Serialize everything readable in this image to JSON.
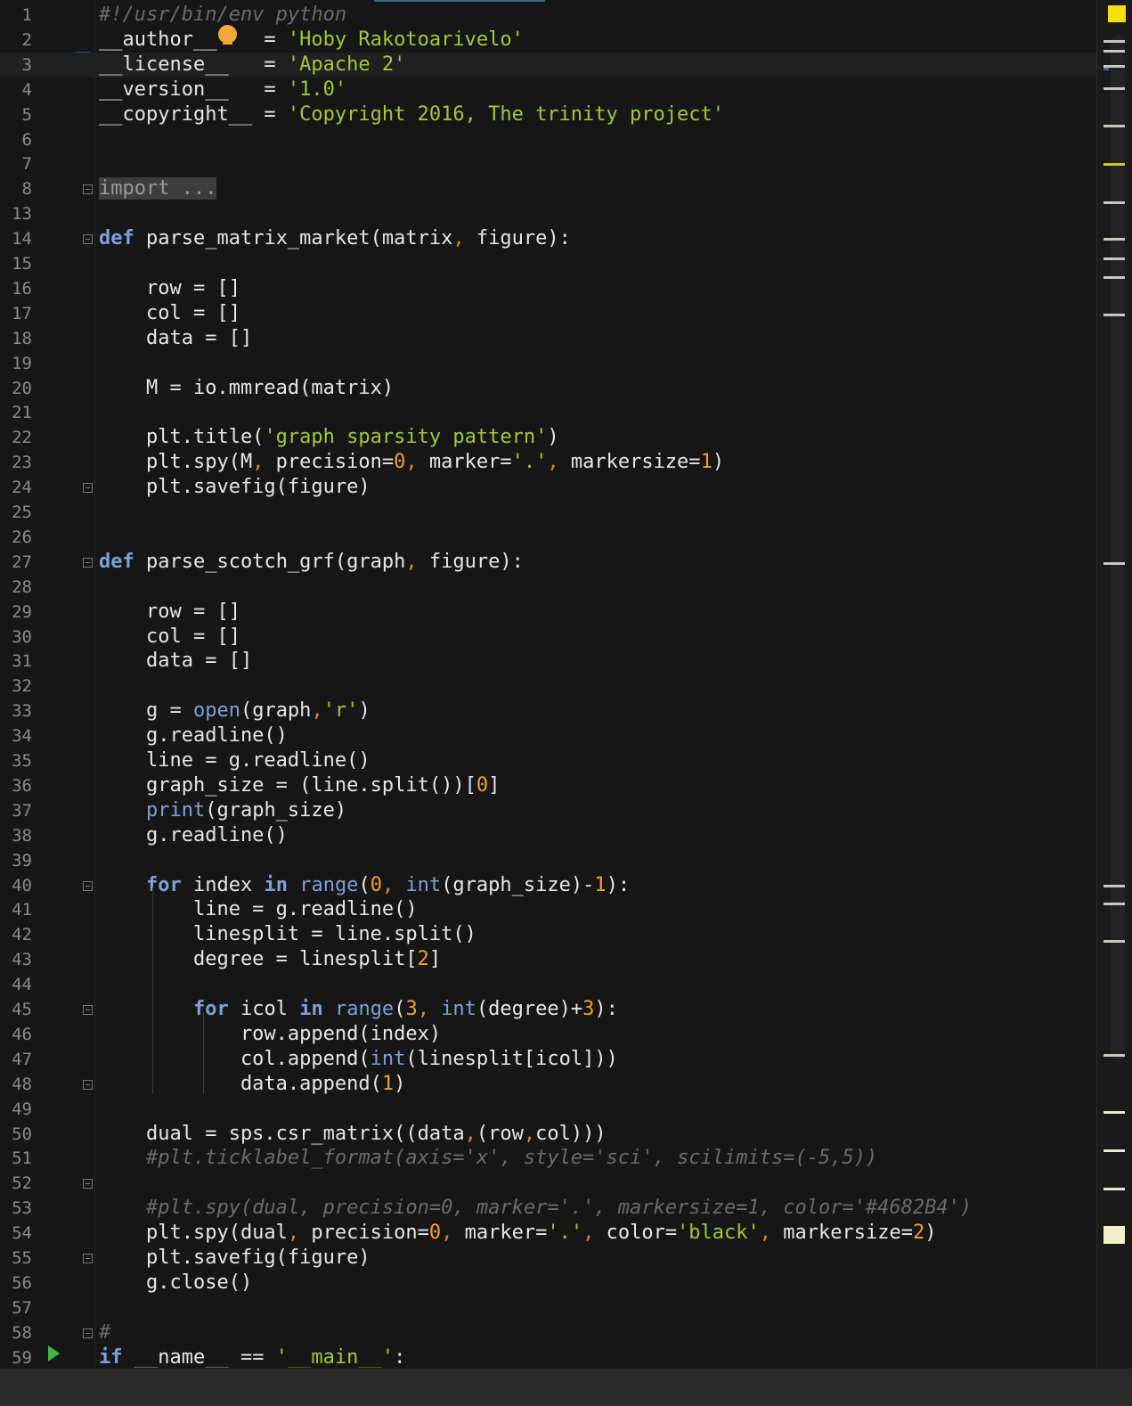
{
  "editor": {
    "language": "python",
    "current_line": 3,
    "lines": [
      {
        "n": "1",
        "t": "#!/usr/bin/env python"
      },
      {
        "n": "2",
        "t": "__author__    = 'Hoby Rakotoarivelo'"
      },
      {
        "n": "3",
        "t": "__license__   = 'Apache 2'"
      },
      {
        "n": "4",
        "t": "__version__   = '1.0'"
      },
      {
        "n": "5",
        "t": "__copyright__ = 'Copyright 2016, The trinity project'"
      },
      {
        "n": "6",
        "t": ""
      },
      {
        "n": "7",
        "t": ""
      },
      {
        "n": "8",
        "t": "import ..."
      },
      {
        "n": "13",
        "t": ""
      },
      {
        "n": "14",
        "t": "def parse_matrix_market(matrix, figure):"
      },
      {
        "n": "15",
        "t": ""
      },
      {
        "n": "16",
        "t": "    row = []"
      },
      {
        "n": "17",
        "t": "    col = []"
      },
      {
        "n": "18",
        "t": "    data = []"
      },
      {
        "n": "19",
        "t": ""
      },
      {
        "n": "20",
        "t": "    M = io.mmread(matrix)"
      },
      {
        "n": "21",
        "t": ""
      },
      {
        "n": "22",
        "t": "    plt.title('graph sparsity pattern')"
      },
      {
        "n": "23",
        "t": "    plt.spy(M, precision=0, marker='.', markersize=1)"
      },
      {
        "n": "24",
        "t": "    plt.savefig(figure)"
      },
      {
        "n": "25",
        "t": ""
      },
      {
        "n": "26",
        "t": ""
      },
      {
        "n": "27",
        "t": "def parse_scotch_grf(graph, figure):"
      },
      {
        "n": "28",
        "t": ""
      },
      {
        "n": "29",
        "t": "    row = []"
      },
      {
        "n": "30",
        "t": "    col = []"
      },
      {
        "n": "31",
        "t": "    data = []"
      },
      {
        "n": "32",
        "t": ""
      },
      {
        "n": "33",
        "t": "    g = open(graph,'r')"
      },
      {
        "n": "34",
        "t": "    g.readline()"
      },
      {
        "n": "35",
        "t": "    line = g.readline()"
      },
      {
        "n": "36",
        "t": "    graph_size = (line.split())[0]"
      },
      {
        "n": "37",
        "t": "    print(graph_size)"
      },
      {
        "n": "38",
        "t": "    g.readline()"
      },
      {
        "n": "39",
        "t": ""
      },
      {
        "n": "40",
        "t": "    for index in range(0, int(graph_size)-1):"
      },
      {
        "n": "41",
        "t": "        line = g.readline()"
      },
      {
        "n": "42",
        "t": "        linesplit = line.split()"
      },
      {
        "n": "43",
        "t": "        degree = linesplit[2]"
      },
      {
        "n": "44",
        "t": ""
      },
      {
        "n": "45",
        "t": "        for icol in range(3, int(degree)+3):"
      },
      {
        "n": "46",
        "t": "            row.append(index)"
      },
      {
        "n": "47",
        "t": "            col.append(int(linesplit[icol]))"
      },
      {
        "n": "48",
        "t": "            data.append(1)"
      },
      {
        "n": "49",
        "t": ""
      },
      {
        "n": "50",
        "t": "    dual = sps.csr_matrix((data,(row,col)))"
      },
      {
        "n": "51",
        "t": "    #plt.ticklabel_format(axis='x', style='sci', scilimits=(-5,5))"
      },
      {
        "n": "52",
        "t": ""
      },
      {
        "n": "53",
        "t": "    #plt.spy(dual, precision=0, marker='.', markersize=1, color='#4682B4')"
      },
      {
        "n": "54",
        "t": "    plt.spy(dual, precision=0, marker='.', color='black', markersize=2)"
      },
      {
        "n": "55",
        "t": "    plt.savefig(figure)"
      },
      {
        "n": "56",
        "t": "    g.close()"
      },
      {
        "n": "57",
        "t": ""
      },
      {
        "n": "58",
        "t": "#"
      },
      {
        "n": "59",
        "t": "if __name__ == '__main__':"
      }
    ]
  },
  "colors": {
    "keyword": "#7f9fd6",
    "string": "#a4c639",
    "number": "#f0a030",
    "comment": "#6b6b6b",
    "background": "#161616",
    "status_indicator": "#f5e000"
  },
  "icons": {
    "lightbulb": "lightbulb-icon",
    "run": "run-icon",
    "fold": "fold-icon"
  }
}
